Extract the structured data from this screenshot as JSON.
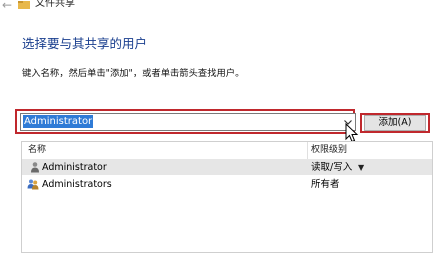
{
  "window": {
    "title": "文件共享"
  },
  "page": {
    "heading": "选择要与其共享的用户",
    "instruction": "键入名称，然后单击\"添加\"，或者单击箭头查找用户。"
  },
  "user_input": {
    "value": "Administrator"
  },
  "add_button": {
    "label": "添加(A)"
  },
  "table": {
    "columns": [
      "名称",
      "权限级别"
    ],
    "rows": [
      {
        "name": "Administrator",
        "permission": "读取/写入",
        "icon": "user-icon",
        "selected": true
      },
      {
        "name": "Administrators",
        "permission": "所有者",
        "icon": "user-group-icon",
        "selected": false
      }
    ]
  },
  "colors": {
    "accent_red": "#c0282d",
    "heading_blue": "#1a3f8f",
    "selection_blue": "#2f7bd6"
  }
}
